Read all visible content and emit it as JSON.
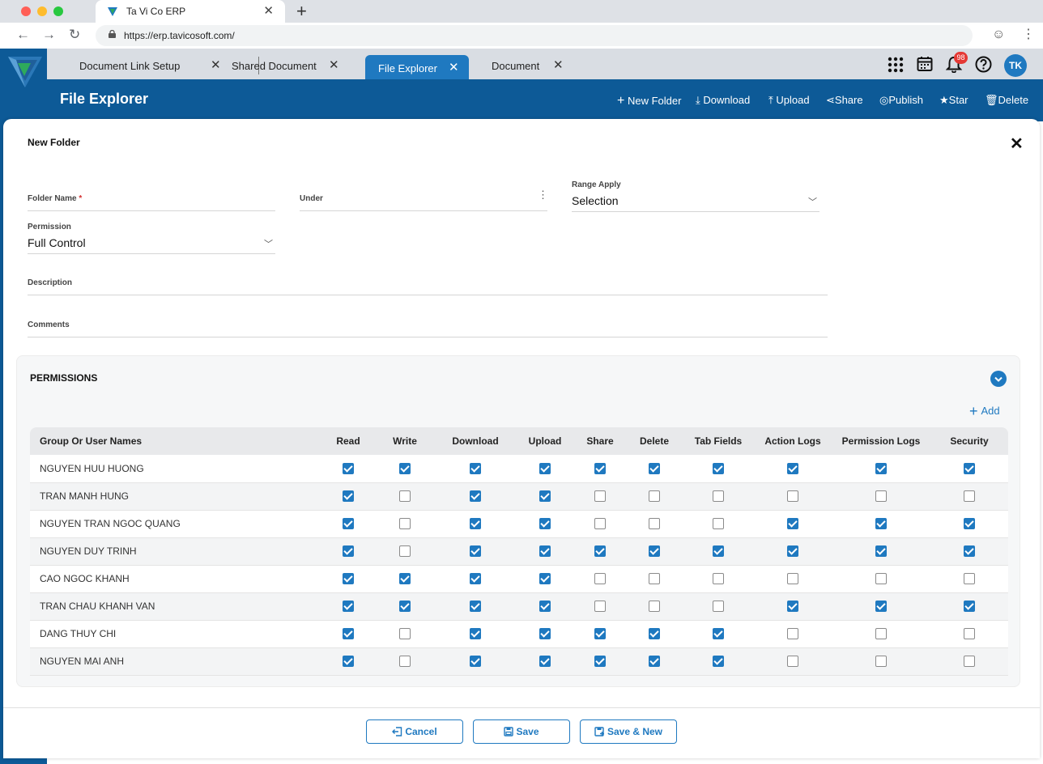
{
  "browser": {
    "tab_title": "Ta Vi Co ERP",
    "url": "https://erp.tavicosoft.com/"
  },
  "app": {
    "tabs": [
      {
        "label": "Document Link Setup"
      },
      {
        "label": "Shared Document"
      },
      {
        "label": "File Explorer",
        "active": true
      },
      {
        "label": "Document"
      }
    ],
    "notification_count": "98",
    "user_initials": "TK",
    "page_title": "File Explorer",
    "actions": {
      "new_folder": "New Folder",
      "download": "Download",
      "upload": "Upload",
      "share": "Share",
      "publish": "Publish",
      "star": "Star",
      "delete": "Delete"
    }
  },
  "modal": {
    "title": "New Folder",
    "fields": {
      "folder_name": {
        "label": "Folder Name",
        "required": "*",
        "value": ""
      },
      "under": {
        "label": "Under",
        "value": ""
      },
      "range_apply": {
        "label": "Range Apply",
        "value": "Selection"
      },
      "permission": {
        "label": "Permission",
        "value": "Full Control"
      },
      "description": {
        "label": "Description",
        "value": ""
      },
      "comments": {
        "label": "Comments",
        "value": ""
      }
    },
    "permissions": {
      "title": "PERMISSIONS",
      "add_label": "Add",
      "columns": [
        "Group Or User Names",
        "Read",
        "Write",
        "Download",
        "Upload",
        "Share",
        "Delete",
        "Tab Fields",
        "Action Logs",
        "Permission Logs",
        "Security"
      ],
      "rows": [
        {
          "name": "NGUYEN HUU HUONG",
          "perms": [
            true,
            true,
            true,
            true,
            true,
            true,
            true,
            true,
            true,
            true
          ]
        },
        {
          "name": "TRAN MANH HUNG",
          "perms": [
            true,
            false,
            true,
            true,
            false,
            false,
            false,
            false,
            false,
            false
          ]
        },
        {
          "name": "NGUYEN TRAN NGOC QUANG",
          "perms": [
            true,
            false,
            true,
            true,
            false,
            false,
            false,
            true,
            true,
            true
          ]
        },
        {
          "name": "NGUYEN DUY TRINH",
          "perms": [
            true,
            false,
            true,
            true,
            true,
            true,
            true,
            true,
            true,
            true
          ]
        },
        {
          "name": "CAO NGOC KHANH",
          "perms": [
            true,
            true,
            true,
            true,
            false,
            false,
            false,
            false,
            false,
            false
          ]
        },
        {
          "name": "TRAN CHAU KHANH VAN",
          "perms": [
            true,
            true,
            true,
            true,
            false,
            false,
            false,
            true,
            true,
            true
          ]
        },
        {
          "name": "DANG THUY CHI",
          "perms": [
            true,
            false,
            true,
            true,
            true,
            true,
            true,
            false,
            false,
            false
          ]
        },
        {
          "name": "NGUYEN MAI ANH",
          "perms": [
            true,
            false,
            true,
            true,
            true,
            true,
            true,
            false,
            false,
            false
          ]
        }
      ]
    },
    "buttons": {
      "cancel": "Cancel",
      "save": "Save",
      "save_new": "Save & New"
    }
  },
  "colors": {
    "brand": "#0d5a97",
    "accent": "#1f79c0"
  }
}
